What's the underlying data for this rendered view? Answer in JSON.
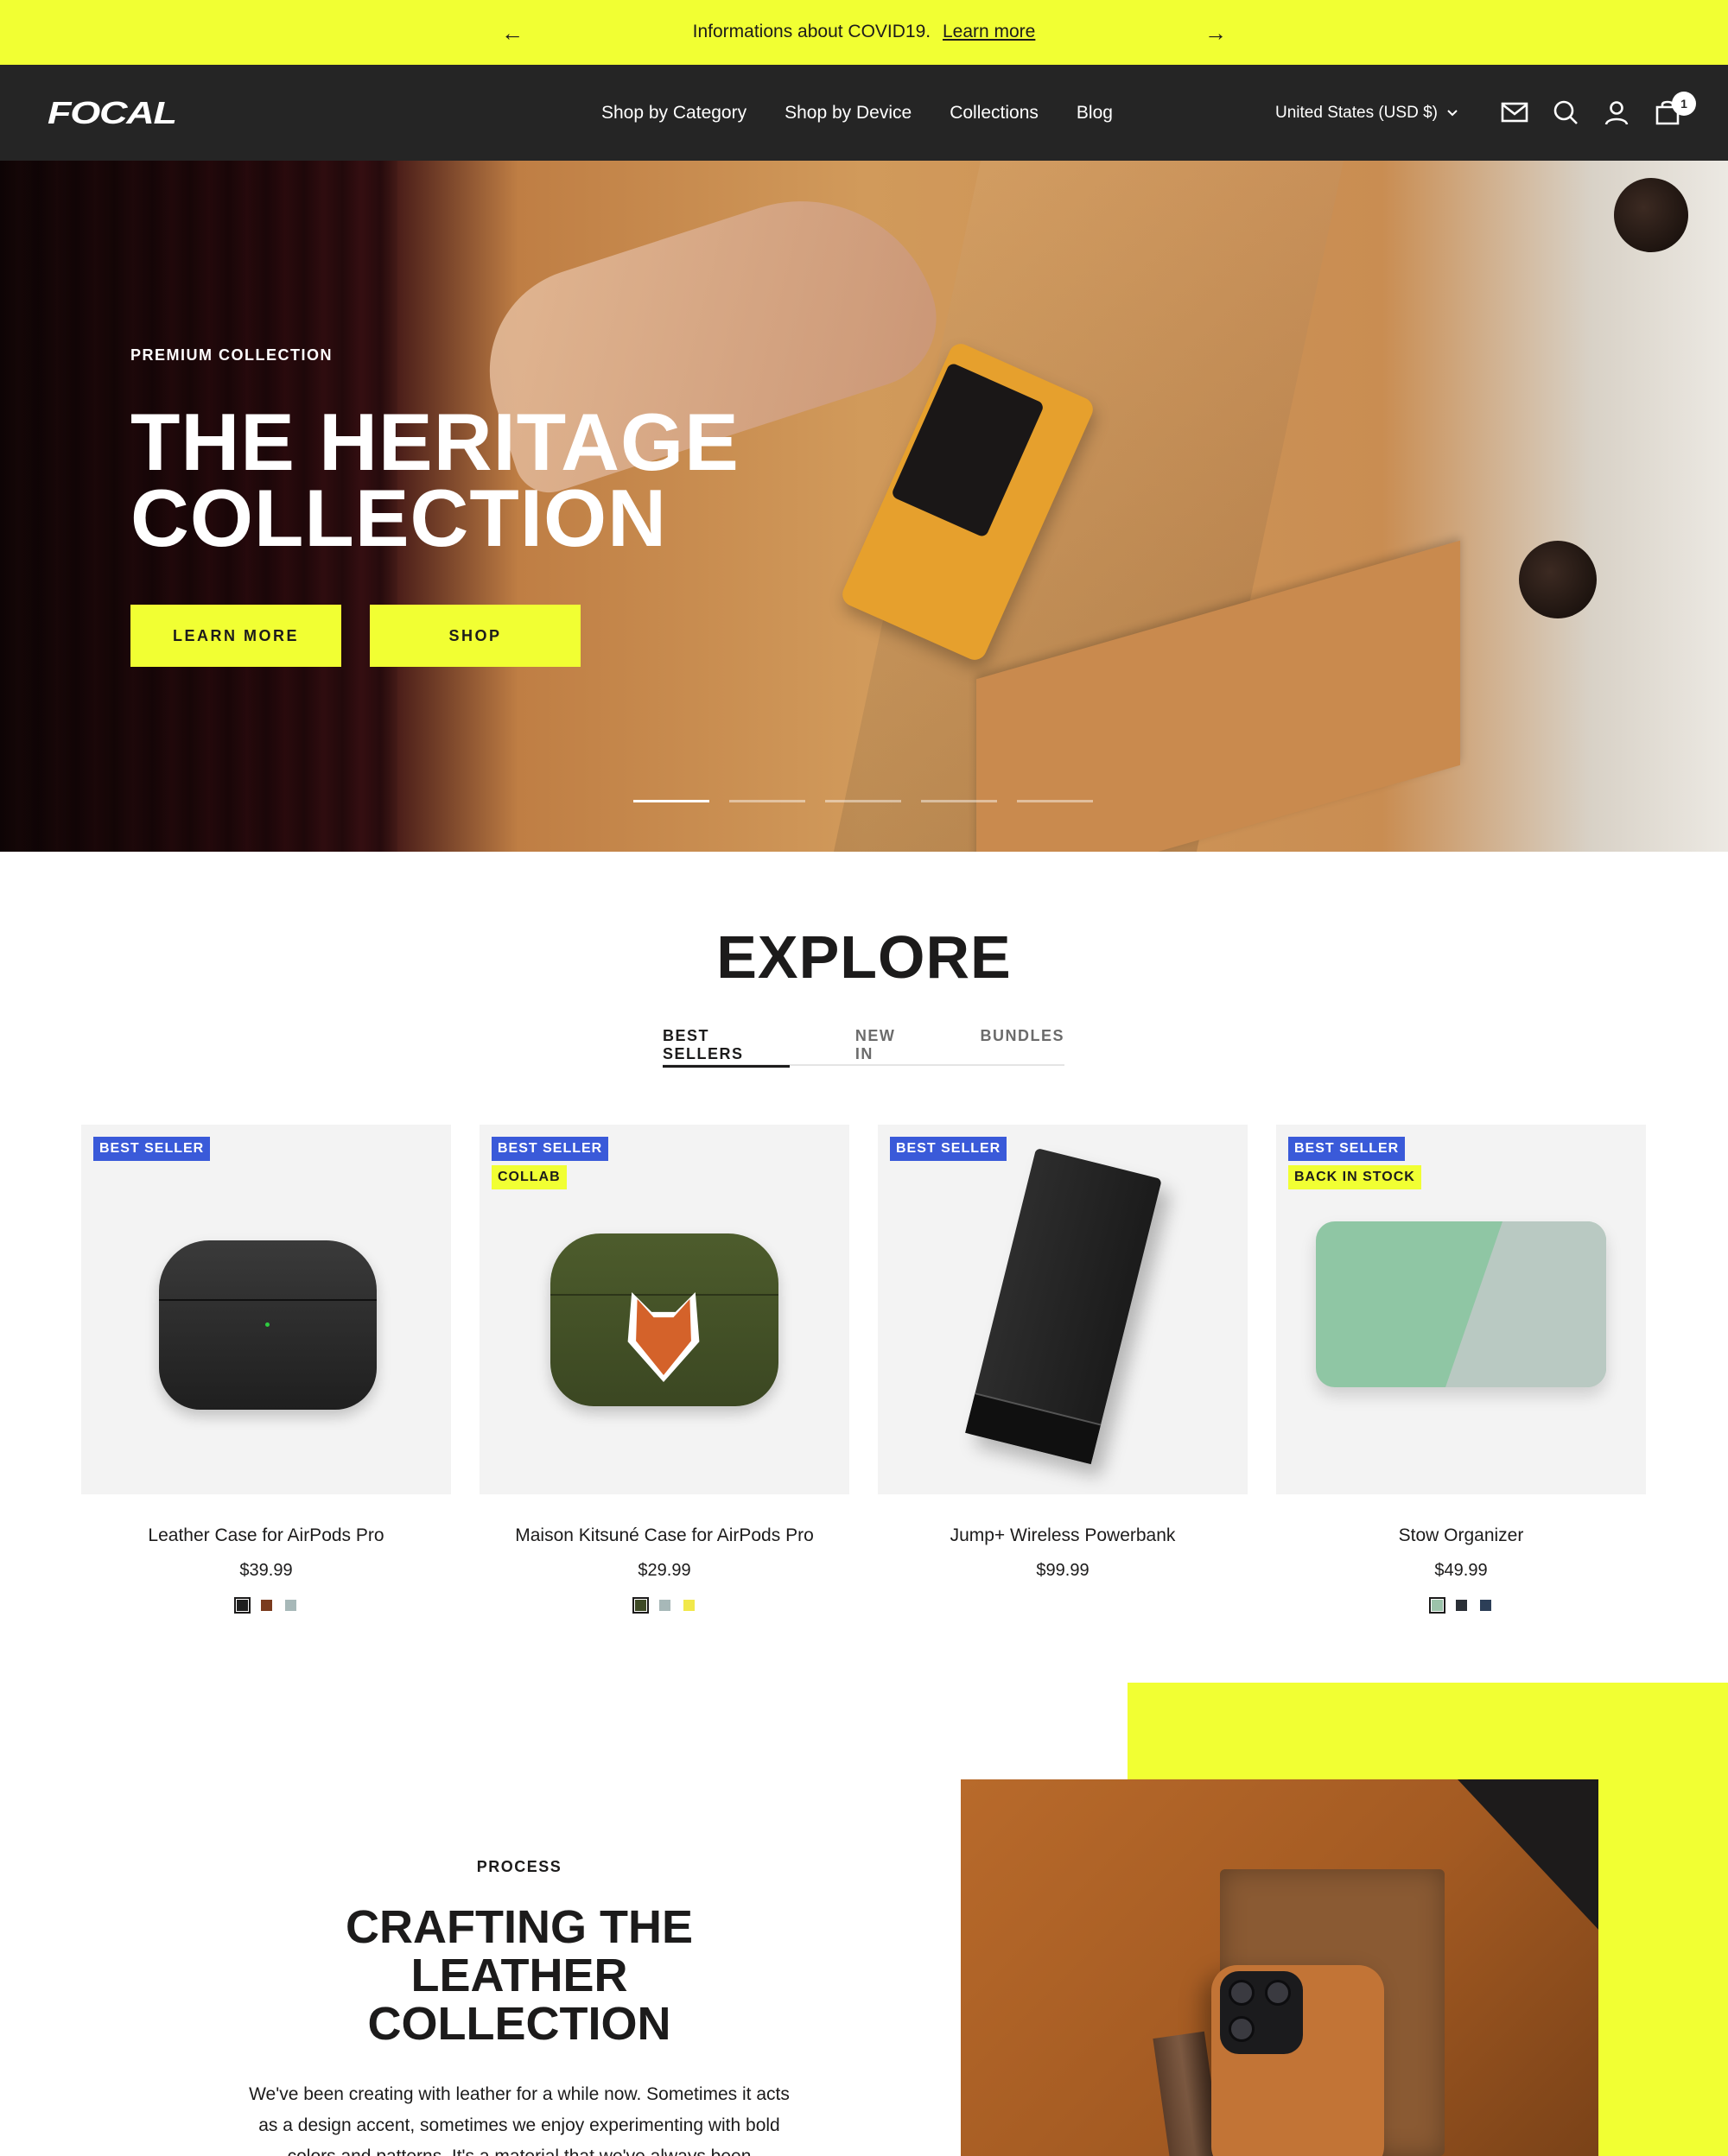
{
  "announcement": {
    "message": "Informations about COVID19.",
    "link_label": "Learn more",
    "prev_icon": "arrow-left-icon",
    "next_icon": "arrow-right-icon"
  },
  "header": {
    "logo": "FOCAL",
    "nav": [
      {
        "label": "Shop by Category"
      },
      {
        "label": "Shop by Device"
      },
      {
        "label": "Collections"
      },
      {
        "label": "Blog"
      }
    ],
    "currency": "United States (USD $)",
    "icons": [
      "mail-icon",
      "search-icon",
      "account-icon",
      "cart-icon"
    ],
    "cart_count": "1"
  },
  "hero": {
    "eyebrow": "PREMIUM COLLECTION",
    "title_line1": "THE HERITAGE",
    "title_line2": "COLLECTION",
    "learn_more": "LEARN MORE",
    "shop": "SHOP",
    "slide_count": 5,
    "active_slide": 1
  },
  "explore": {
    "title": "EXPLORE",
    "tabs": [
      {
        "label": "BEST SELLERS",
        "active": true
      },
      {
        "label": "NEW IN",
        "active": false
      },
      {
        "label": "BUNDLES",
        "active": false
      }
    ],
    "products": [
      {
        "badges": [
          {
            "label": "BEST SELLER",
            "color": "blue"
          }
        ],
        "name": "Leather Case for AirPods Pro",
        "price": "$39.99",
        "swatches": [
          "#1f1f1f",
          "#7a3b1e",
          "#a7b8b8"
        ],
        "selected_swatch": 0
      },
      {
        "badges": [
          {
            "label": "BEST SELLER",
            "color": "blue"
          },
          {
            "label": "COLLAB",
            "color": "yellow"
          }
        ],
        "name": "Maison Kitsuné Case for AirPods Pro",
        "price": "$29.99",
        "swatches": [
          "#3e4a25",
          "#a7b8b8",
          "#f1e84a"
        ],
        "selected_swatch": 0
      },
      {
        "badges": [
          {
            "label": "BEST SELLER",
            "color": "blue"
          }
        ],
        "name": "Jump+ Wireless Powerbank",
        "price": "$99.99",
        "swatches": [],
        "selected_swatch": null
      },
      {
        "badges": [
          {
            "label": "BEST SELLER",
            "color": "blue"
          },
          {
            "label": "BACK IN STOCK",
            "color": "yellow"
          }
        ],
        "name": "Stow Organizer",
        "price": "$49.99",
        "swatches": [
          "#9cc3aa",
          "#2a2f36",
          "#2c3e57"
        ],
        "selected_swatch": 0
      }
    ]
  },
  "process": {
    "eyebrow": "PROCESS",
    "title": "CRAFTING THE LEATHER COLLECTION",
    "text": "We've been creating with leather for a while now. Sometimes it acts as a design accent, sometimes we enjoy experimenting with bold colors and patterns. It's a material that we've always been"
  },
  "colors": {
    "accent_yellow": "#f1ff33",
    "header_bg": "#252525",
    "badge_blue": "#3a5ad9",
    "text_dark": "#1c1b1b"
  }
}
